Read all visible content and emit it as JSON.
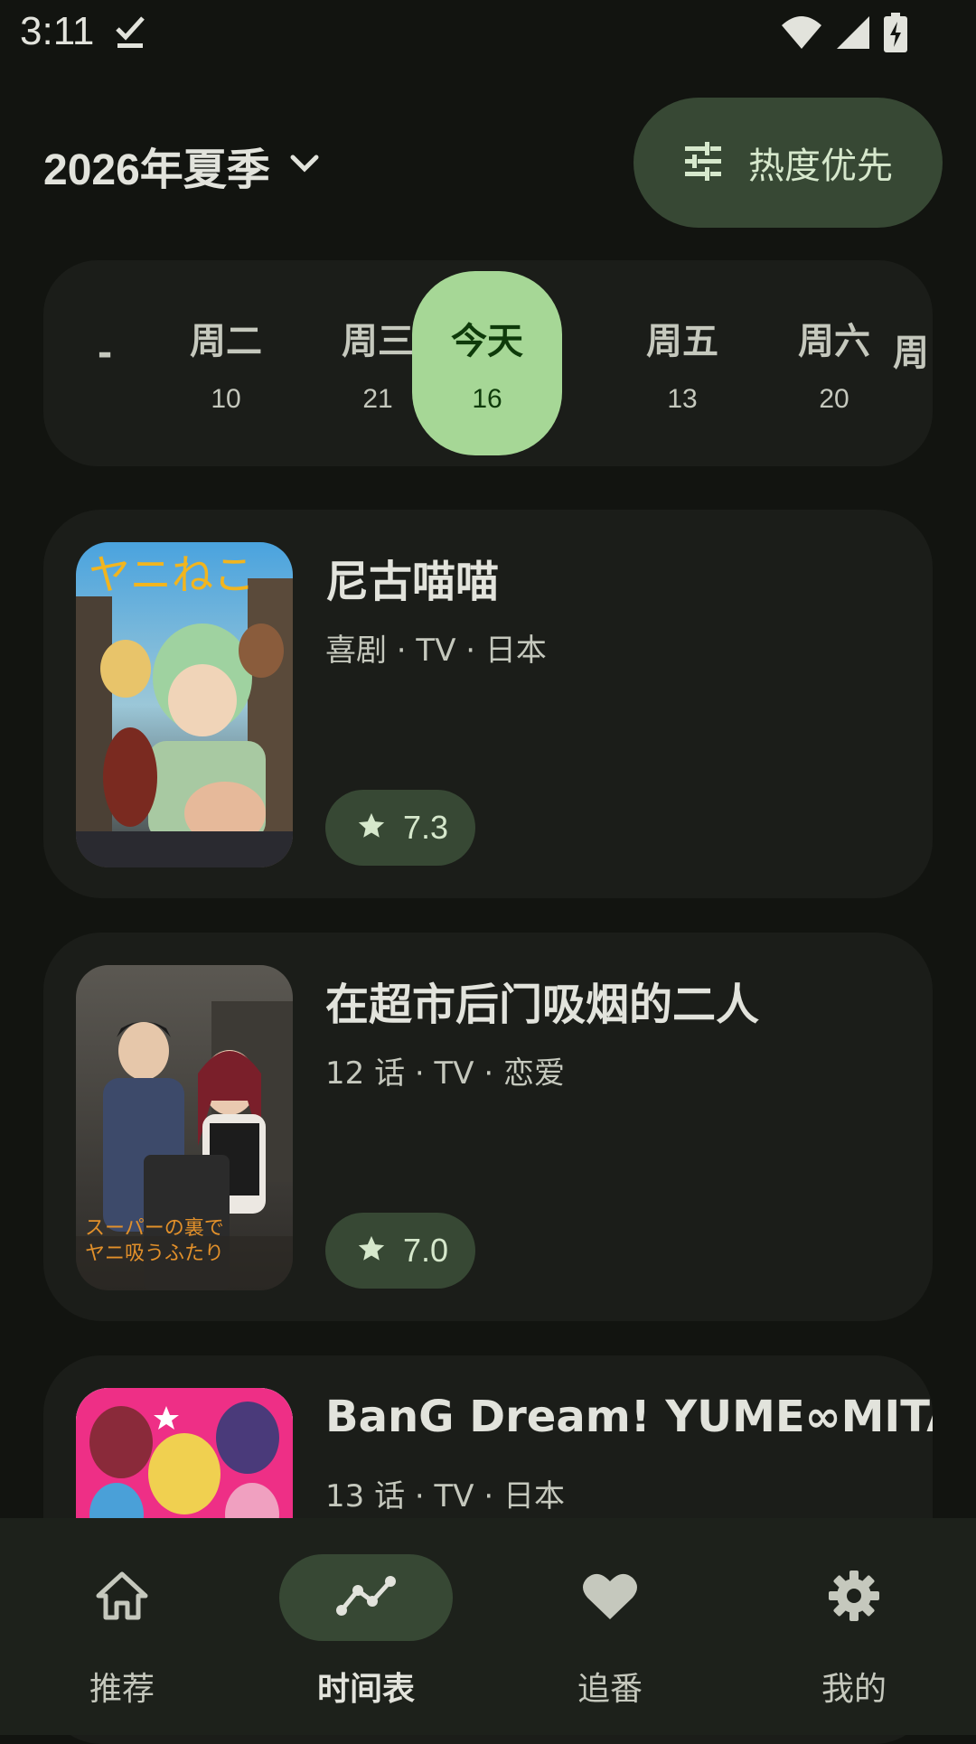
{
  "status_bar": {
    "time": "3:11"
  },
  "header": {
    "season_label": "2026年夏季",
    "sort_label": "热度优先"
  },
  "day_selector": {
    "partial_left": "-",
    "days": [
      {
        "name": "周二",
        "count": "10"
      },
      {
        "name": "周三",
        "count": "21"
      },
      {
        "name": "今天",
        "count": "16",
        "selected": true
      },
      {
        "name": "周五",
        "count": "13"
      },
      {
        "name": "周六",
        "count": "20"
      }
    ],
    "partial_right": "周"
  },
  "shows": [
    {
      "title": "尼古喵喵",
      "meta": "喜剧 · TV · 日本",
      "rating": "7.3",
      "poster_text": "ヤニねこ"
    },
    {
      "title": "在超市后门吸烟的二人",
      "meta": "12 话 · TV · 恋爱",
      "rating": "7.0",
      "poster_text": "スーパーの裏でヤニ吸うふたり"
    },
    {
      "title": "BanG Dream! YUME∞MITA",
      "meta": "13 话 · TV · 日本",
      "rating": ""
    }
  ],
  "bottom_nav": {
    "items": [
      {
        "label": "推荐",
        "icon": "home-icon"
      },
      {
        "label": "时间表",
        "icon": "timeline-icon",
        "active": true
      },
      {
        "label": "追番",
        "icon": "heart-icon"
      },
      {
        "label": "我的",
        "icon": "settings-icon"
      }
    ]
  },
  "colors": {
    "background": "#121410",
    "surface": "#1b1d19",
    "accent_container": "#374834",
    "selected_day": "#a6d796"
  }
}
